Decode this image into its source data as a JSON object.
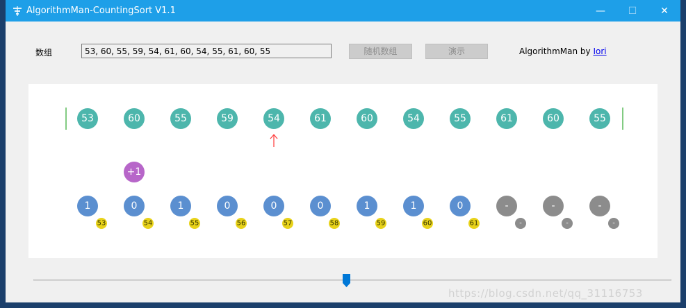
{
  "window": {
    "title": "AlgorithmMan-CountingSort V1.1",
    "controls": {
      "minimize": "—",
      "maximize": "☐",
      "close": "✕"
    }
  },
  "toolbar": {
    "array_label": "数组",
    "array_value": "53, 60, 55, 59, 54, 61, 60, 54, 55, 61, 60, 55",
    "random_button": "随机数组",
    "demo_button": "演示",
    "credit_prefix": "AlgorithmMan by ",
    "credit_link": "Iori"
  },
  "visualization": {
    "input_values": [
      "53",
      "60",
      "55",
      "59",
      "54",
      "61",
      "60",
      "54",
      "55",
      "61",
      "60",
      "55"
    ],
    "current_index": 4,
    "increment_label": "+1",
    "increment_index": 1,
    "counts": [
      "1",
      "0",
      "1",
      "0",
      "0",
      "0",
      "1",
      "1",
      "0",
      "-",
      "-",
      "-"
    ],
    "keys": [
      "53",
      "54",
      "55",
      "56",
      "57",
      "58",
      "59",
      "60",
      "61",
      "-",
      "-",
      "-"
    ],
    "colors": {
      "input": "#4db6ac",
      "count_active": "#5b8fd0",
      "count_empty": "#8c8c8c",
      "key": "#e8d21a",
      "key_empty": "#8c8c8c",
      "increment": "#b766c9",
      "pointer": "#ff3b3b",
      "boundary": "#2ea82e"
    }
  },
  "slider": {
    "position_fraction": 0.49
  },
  "watermark": "https://blog.csdn.net/qq_31116753"
}
